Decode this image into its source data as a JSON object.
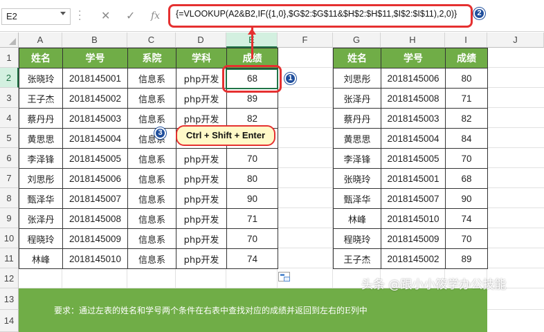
{
  "formula_bar": {
    "name_box": "E2",
    "cancel_icon": "✕",
    "enter_icon": "✓",
    "fx_icon": "fx",
    "formula": "{=VLOOKUP(A2&B2,IF({1,0},$G$2:$G$11&$H$2:$H$11,$I$2:$I$11),2,0)}"
  },
  "columns": [
    "A",
    "B",
    "C",
    "D",
    "E",
    "F",
    "G",
    "H",
    "I",
    "J"
  ],
  "rows": [
    "1",
    "2",
    "3",
    "4",
    "5",
    "6",
    "7",
    "8",
    "9",
    "10",
    "11",
    "12",
    "13",
    "14"
  ],
  "left_table": {
    "headers": [
      "姓名",
      "学号",
      "系院",
      "学科",
      "成绩"
    ],
    "rows": [
      [
        "张晓玲",
        "2018145001",
        "信息系",
        "php开发",
        "68"
      ],
      [
        "王子杰",
        "2018145002",
        "信息系",
        "php开发",
        "89"
      ],
      [
        "蔡丹丹",
        "2018145003",
        "信息系",
        "php开发",
        "82"
      ],
      [
        "黄思思",
        "2018145004",
        "信息系",
        "php开发",
        ""
      ],
      [
        "李泽锋",
        "2018145005",
        "信息系",
        "php开发",
        "70"
      ],
      [
        "刘思彤",
        "2018145006",
        "信息系",
        "php开发",
        "80"
      ],
      [
        "甄泽华",
        "2018145007",
        "信息系",
        "php开发",
        "90"
      ],
      [
        "张泽丹",
        "2018145008",
        "信息系",
        "php开发",
        "71"
      ],
      [
        "程晓玲",
        "2018145009",
        "信息系",
        "php开发",
        "70"
      ],
      [
        "林峰",
        "2018145010",
        "信息系",
        "php开发",
        "74"
      ]
    ]
  },
  "right_table": {
    "headers": [
      "姓名",
      "学号",
      "成绩"
    ],
    "rows": [
      [
        "刘思彤",
        "2018145006",
        "80"
      ],
      [
        "张泽丹",
        "2018145008",
        "71"
      ],
      [
        "蔡丹丹",
        "2018145003",
        "82"
      ],
      [
        "黄思思",
        "2018145004",
        "84"
      ],
      [
        "李泽锋",
        "2018145005",
        "70"
      ],
      [
        "张晓玲",
        "2018145001",
        "68"
      ],
      [
        "甄泽华",
        "2018145007",
        "90"
      ],
      [
        "林峰",
        "2018145010",
        "74"
      ],
      [
        "程晓玲",
        "2018145009",
        "70"
      ],
      [
        "王子杰",
        "2018145002",
        "89"
      ]
    ]
  },
  "annotations": {
    "badge1": "1",
    "badge2": "2",
    "badge3": "3",
    "shortcut_tip": "Ctrl + Shift + Enter"
  },
  "requirement": "要求：通过左表的姓名和学号两个条件在右表中查找对应的成绩并返回到左右的E列中",
  "watermark": "头条 @跟小小筱学办公技能",
  "colors": {
    "header_green": "#70ad47",
    "highlight_red": "#e53030",
    "badge_blue": "#1f4e9c",
    "tip_yellow": "#fff9c8",
    "excel_green": "#217346"
  },
  "icons": {
    "cancel": "close-icon",
    "enter": "check-icon",
    "function": "fx-icon",
    "paste_options": "paste-options-icon"
  }
}
